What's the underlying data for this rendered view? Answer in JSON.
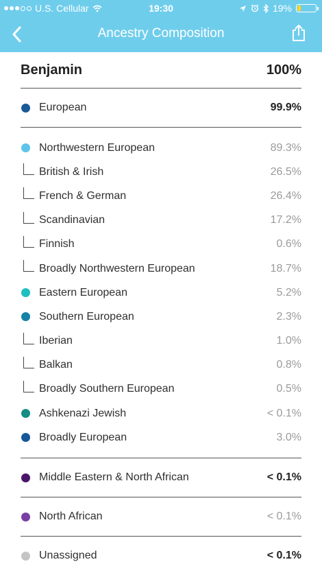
{
  "status_bar": {
    "carrier": "U.S. Cellular",
    "time": "19:30",
    "battery_percent": "19%",
    "battery_level": 0.19
  },
  "nav": {
    "title": "Ancestry Composition"
  },
  "header": {
    "name": "Benjamin",
    "total": "100%"
  },
  "colors": {
    "nav_bar": "#6fcdec",
    "european": "#1a5a96",
    "northwestern": "#5bc4ea",
    "eastern": "#1dbfbf",
    "southern": "#1682a6",
    "ashkenazi": "#158c86",
    "broadly_european": "#16579a",
    "middle_eastern": "#4a1768",
    "north_african": "#7a3fa5",
    "unassigned": "#c4c4c4"
  },
  "european_summary": {
    "label": "European",
    "value": "99.9%"
  },
  "european_breakdown": [
    {
      "label": "Northwestern European",
      "value": "89.3%",
      "kind": "bullet",
      "color": "#5bc4ea"
    },
    {
      "label": "British & Irish",
      "value": "26.5%",
      "kind": "tree"
    },
    {
      "label": "French & German",
      "value": "26.4%",
      "kind": "tree"
    },
    {
      "label": "Scandinavian",
      "value": "17.2%",
      "kind": "tree"
    },
    {
      "label": "Finnish",
      "value": "0.6%",
      "kind": "tree"
    },
    {
      "label": "Broadly Northwestern European",
      "value": "18.7%",
      "kind": "tree"
    },
    {
      "label": "Eastern European",
      "value": "5.2%",
      "kind": "bullet",
      "color": "#1dbfbf"
    },
    {
      "label": "Southern European",
      "value": "2.3%",
      "kind": "bullet",
      "color": "#1682a6"
    },
    {
      "label": "Iberian",
      "value": "1.0%",
      "kind": "tree"
    },
    {
      "label": "Balkan",
      "value": "0.8%",
      "kind": "tree"
    },
    {
      "label": "Broadly Southern European",
      "value": "0.5%",
      "kind": "tree"
    },
    {
      "label": "Ashkenazi Jewish",
      "value": "< 0.1%",
      "kind": "bullet",
      "color": "#158c86"
    },
    {
      "label": "Broadly European",
      "value": "3.0%",
      "kind": "bullet",
      "color": "#16579a"
    }
  ],
  "middle_eastern_summary": {
    "label": "Middle Eastern & North African",
    "value": "< 0.1%"
  },
  "north_african": {
    "label": "North African",
    "value": "< 0.1%"
  },
  "unassigned": {
    "label": "Unassigned",
    "value": "< 0.1%"
  }
}
